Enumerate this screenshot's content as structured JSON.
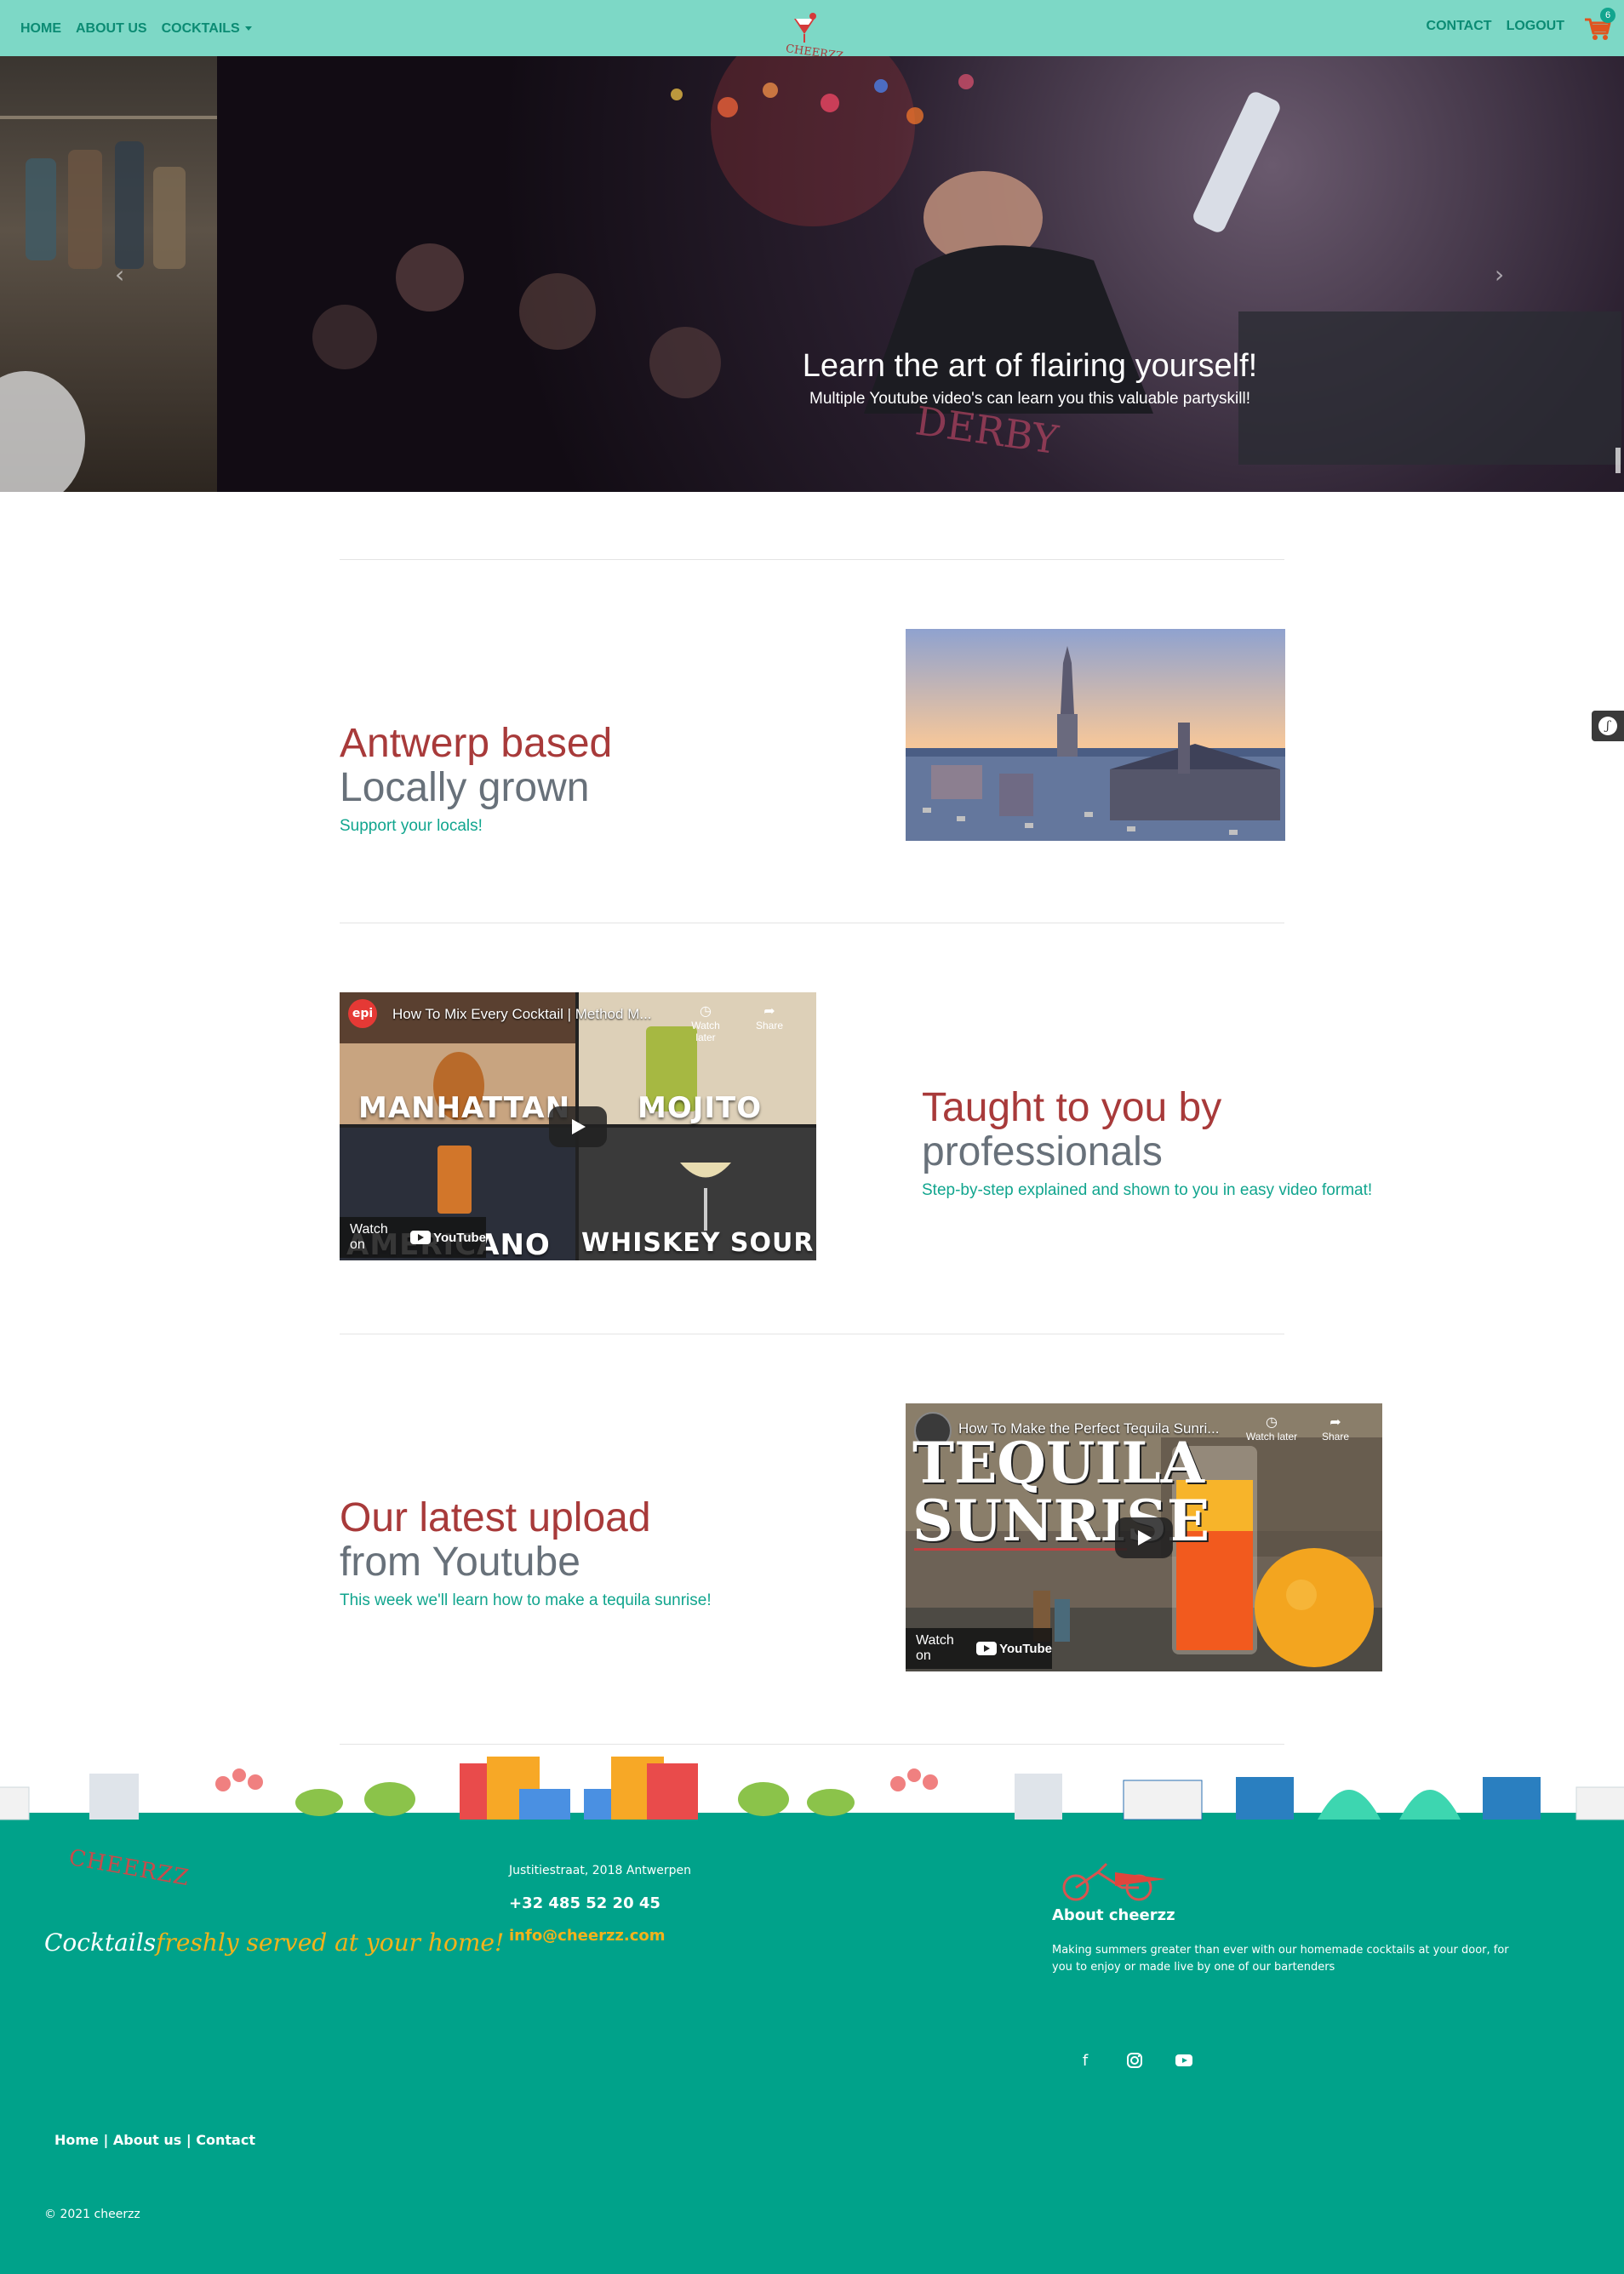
{
  "nav": {
    "left": [
      "HOME",
      "ABOUT US",
      "COCKTAILS"
    ],
    "right": [
      "CONTACT",
      "LOGOUT"
    ],
    "brand": "CHEERZZ",
    "cart_count": "6"
  },
  "hero": {
    "title": "Learn the art of flairing yourself!",
    "subtitle": "Multiple Youtube video's can learn you this valuable partyskill!"
  },
  "section1": {
    "title_red": "Antwerp based",
    "title_gray": "Locally grown",
    "subtitle": "Support your locals!"
  },
  "section2": {
    "title_red": "Taught to you by",
    "title_gray": "professionals",
    "subtitle": "Step-by-step explained and shown to you in easy video format!",
    "video": {
      "channel": "epi",
      "title": "How To Mix Every Cocktail | Method M...",
      "watch_later": "Watch later",
      "share": "Share",
      "watch_on": "Watch on",
      "youtube": "YouTube",
      "tiles": [
        "MANHATTAN",
        "MOJITO",
        "AMERICANO",
        "WHISKEY SOUR"
      ]
    }
  },
  "section3": {
    "title_red": "Our latest upload",
    "title_gray": "from Youtube",
    "subtitle": "This week we'll learn how to make a tequila sunrise!",
    "video": {
      "title": "How To Make the Perfect Tequila Sunri...",
      "watch_later": "Watch later",
      "share": "Share",
      "watch_on": "Watch on",
      "youtube": "YouTube",
      "art_line1": "TEQUILA",
      "art_line2": "SUNRISE"
    }
  },
  "footer": {
    "logo": "CHEERZZ",
    "tagline_white": "Cocktails",
    "tagline_yellow": "freshly served at your home!",
    "address": "Justitiestraat, 2018 Antwerpen",
    "phone": "+32 485 52 20 45",
    "email": "info@cheerzz.com",
    "about_title": "About cheerzz",
    "about_text": "Making summers greater than ever with our homemade cocktails at your door, for you to enjoy or made live by one of our bartenders",
    "links": [
      "Home",
      "About us",
      "Contact"
    ],
    "copyright": "© 2021 cheerzz"
  },
  "colors": {
    "navbar": "#7dd8c6",
    "nav_text": "#0b8b73",
    "title_red": "#a83a3a",
    "title_gray": "#68717a",
    "accent_teal": "#11a58e",
    "footer": "#00a28a",
    "yellow": "#f3b21b"
  },
  "icons": [
    "cocktail-logo-icon",
    "cart-icon",
    "chevron-left-icon",
    "chevron-right-icon",
    "play-icon",
    "clock-icon",
    "share-icon",
    "facebook-icon",
    "instagram-icon",
    "youtube-icon",
    "bicycle-icon"
  ]
}
